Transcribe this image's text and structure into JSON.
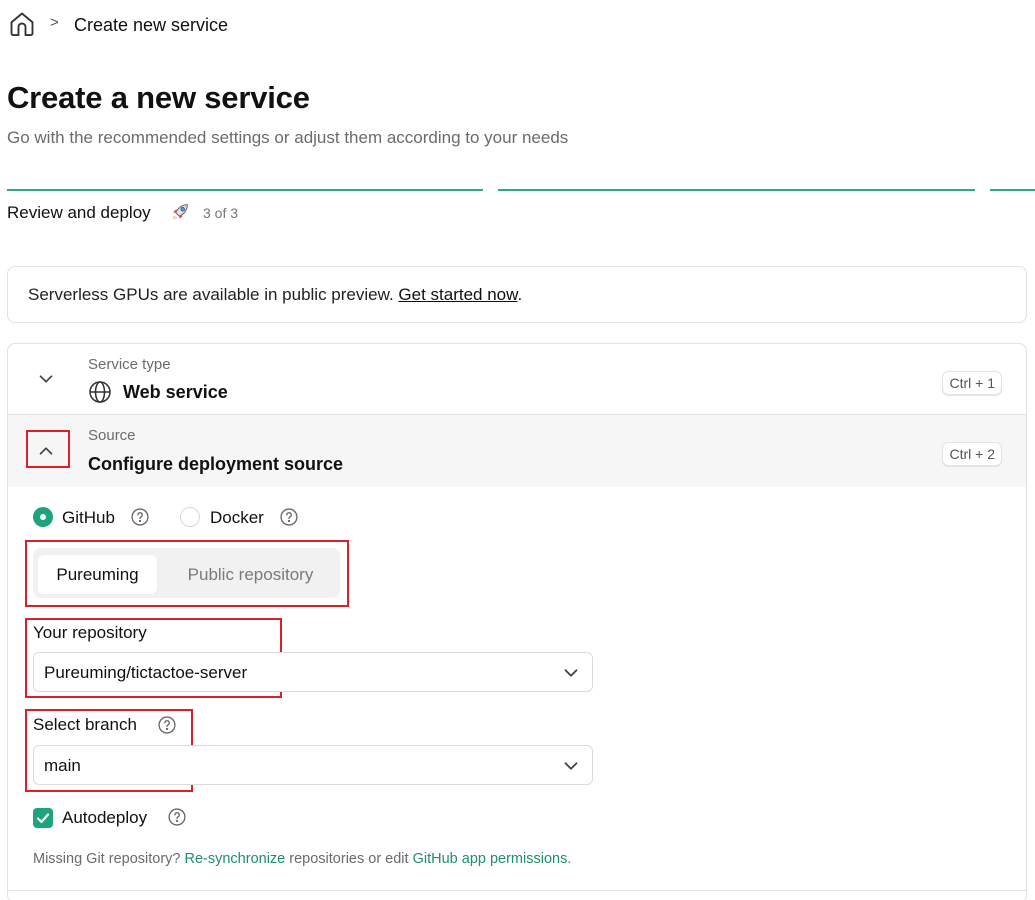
{
  "breadcrumb": {
    "home_icon": "home-icon",
    "separator": ">",
    "current": "Create new service"
  },
  "page": {
    "title": "Create a new service",
    "subtitle": "Go with the recommended settings or adjust them according to your needs"
  },
  "stepper": {
    "label": "Review and deploy",
    "icon": "rocket-icon",
    "count": "3 of 3",
    "accent_color": "#2ea98a"
  },
  "banner": {
    "text": "Serverless GPUs are available in public preview. ",
    "link": "Get started now",
    "suffix": "."
  },
  "sections": {
    "service_type": {
      "eyebrow": "Service type",
      "title": "Web service",
      "icon": "globe-icon",
      "shortcut": "Ctrl + 1",
      "expanded": false
    },
    "source": {
      "eyebrow": "Source",
      "title": "Configure deployment source",
      "shortcut": "Ctrl + 2",
      "expanded": true
    }
  },
  "source_form": {
    "source_options": [
      {
        "label": "GitHub",
        "selected": true
      },
      {
        "label": "Docker",
        "selected": false
      }
    ],
    "repo_tabs": [
      {
        "label": "Pureuming",
        "active": true
      },
      {
        "label": "Public repository",
        "active": false
      }
    ],
    "repository": {
      "label": "Your repository",
      "value": "Pureuming/tictactoe-server"
    },
    "branch": {
      "label": "Select branch",
      "value": "main"
    },
    "autodeploy": {
      "label": "Autodeploy",
      "checked": true
    },
    "footnote": {
      "prefix": "Missing Git repository? ",
      "link1": "Re-synchronize",
      "middle": " repositories or edit ",
      "link2": "GitHub app permissions",
      "suffix": "."
    },
    "brand_color": "#1ea37f",
    "highlight_color": "#d8222a"
  }
}
